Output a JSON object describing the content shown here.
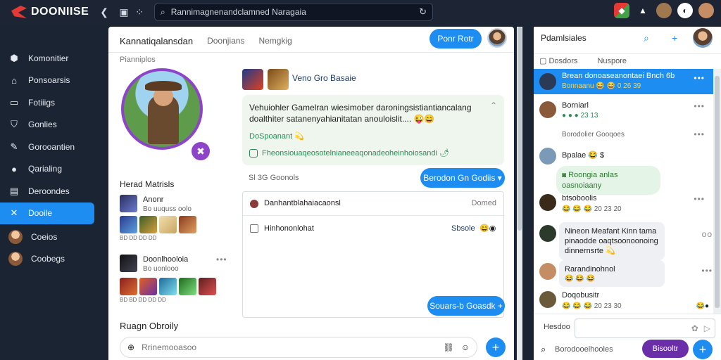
{
  "app": {
    "name": "DOONIISE"
  },
  "topbar": {
    "search_value": "Rannimagnenandclamned Naragaia",
    "icons": [
      "back-icon",
      "bookmark-icon",
      "grid-icon",
      "search-icon",
      "refresh-icon"
    ]
  },
  "sidebar": {
    "items": [
      {
        "label": "Komonitier",
        "icon": "puzzle-icon"
      },
      {
        "label": "Ponsoarsis",
        "icon": "home-icon"
      },
      {
        "label": "Fotiiigs",
        "icon": "card-icon"
      },
      {
        "label": "Gonlies",
        "icon": "shield-icon"
      },
      {
        "label": "Gorooantien",
        "icon": "wrench-icon"
      },
      {
        "label": "Qarialing",
        "icon": "disc-icon"
      },
      {
        "label": "Deroondes",
        "icon": "inbox-icon"
      },
      {
        "label": "Dooile",
        "icon": "cross-tools-icon"
      },
      {
        "label": "Coeios",
        "icon": "avatar"
      },
      {
        "label": "Coobegs",
        "icon": "avatar"
      }
    ],
    "active_index": 7
  },
  "main": {
    "tabs": [
      "Kannatiqalansdan",
      "Doonjians",
      "Nemgkig"
    ],
    "head_button": "Ponr Rotr",
    "profile_label": "Pianniplos",
    "section_left_title": "Herad Matrisls",
    "mini_groups": [
      {
        "name": "Anonr",
        "sub": "Bo uuquss oolo"
      },
      {
        "name": "Doonlhooloia",
        "sub": "Bo uonlooo"
      }
    ],
    "row1_sub": "BD  DD  DD  DD",
    "row2_sub": "BD  BD  DD  DD  DD",
    "card_title": "Veno Gro Basaie",
    "post_text": "Vehuiohler Gamelran wiesimober daroningsistiantiancalang doalthiter satanenyahianitatan anouloislit.... 😜😄",
    "post_link": "DoSpoanant",
    "post_link_emoji": "💫",
    "post_note": "Fheonsiouaqeosotelnianeeaqonadeoheinhoiosandi",
    "post_note_emoji": "🌶",
    "crumb": "Sl  3G  Goonols",
    "blue_button_top": "Berodon Gn Godiis",
    "panel_row1_left": "Danhantblahaiacaonsl",
    "panel_row1_right": "Domed",
    "panel_row2_left": "Hinhononlohat",
    "panel_row2_right": "Sbsole",
    "blue_button_bottom": "Souars-b Goasdk",
    "section_bottom_title": "Ruagn Obroily",
    "composer_placeholder": "Rrinemooasoo"
  },
  "right": {
    "title": "Pdamlsiales",
    "tabs": [
      "Dosdors",
      "Nuspore"
    ],
    "chats": [
      {
        "name": "Brean donoaseanontaei Bnch 6b",
        "sub": "Bonnaanu 😂 😂 0 26 39"
      },
      {
        "name": "Borniarl",
        "sub": "● ● ● 23 13"
      },
      {
        "name": "",
        "sub": "Borodolier Gooqoes"
      },
      {
        "name": "Bpalae 😂 $",
        "sub": ""
      },
      {
        "name": "",
        "sub": "Roongia anlas oasnoiaany"
      },
      {
        "name": "btsoboolis",
        "sub": "😂 😂 😂 20 23 20"
      },
      {
        "name": "Nineon Meafant Kinn tama",
        "sub": "pinaodde oaqtsoonoonoing"
      },
      {
        "name": "dinnernsrte 💫",
        "sub": ""
      },
      {
        "name": "Rarandinohnol",
        "sub": "😂 😂 😂"
      },
      {
        "name": "Doqobusitr",
        "sub": "😂 😂 😂  20 23 30"
      }
    ],
    "input_label": "Hesdoo",
    "footer_search": "Borodooelhooles",
    "purple_button": "Bisooltr"
  },
  "colors": {
    "accent": "#1e8df2",
    "sidebar_bg": "#1b2433",
    "purple": "#8e44c9"
  }
}
